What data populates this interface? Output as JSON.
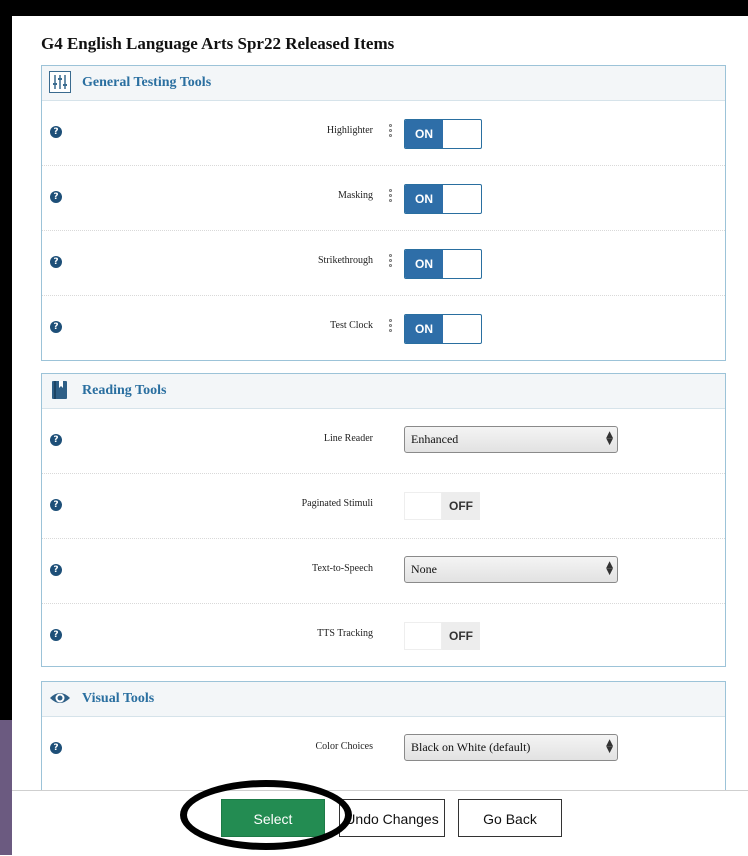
{
  "title": "G4 English Language Arts Spr22 Released Items",
  "sections": [
    {
      "label": "General Testing Tools",
      "icon": "sliders-icon",
      "rows": [
        {
          "label": "Highlighter",
          "toggle": "ON"
        },
        {
          "label": "Masking",
          "toggle": "ON"
        },
        {
          "label": "Strikethrough",
          "toggle": "ON"
        },
        {
          "label": "Test Clock",
          "toggle": "ON"
        }
      ]
    },
    {
      "label": "Reading Tools",
      "icon": "book-icon",
      "rows": [
        {
          "label": "Line Reader",
          "select": "Enhanced"
        },
        {
          "label": "Paginated Stimuli",
          "toggle": "OFF"
        },
        {
          "label": "Text-to-Speech",
          "select": "None"
        },
        {
          "label": "TTS Tracking",
          "toggle": "OFF"
        }
      ]
    },
    {
      "label": "Visual Tools",
      "icon": "eye-icon",
      "rows": [
        {
          "label": "Color Choices",
          "select": "Black on White (default)"
        }
      ]
    }
  ],
  "footer": {
    "select_label": "Select",
    "undo_label": "Undo Changes",
    "back_label": "Go Back"
  },
  "colors": {
    "accent": "#2e6ea8",
    "section_label": "#2a6fa0",
    "select_button": "#238c52"
  }
}
